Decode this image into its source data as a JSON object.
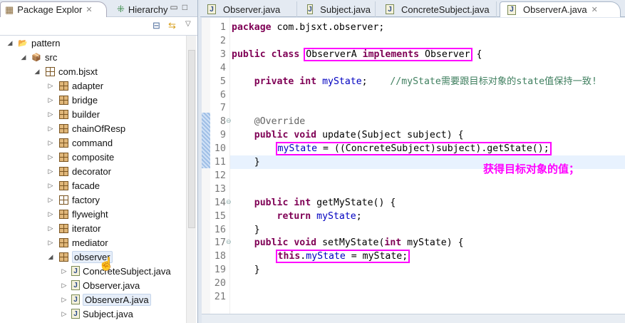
{
  "left_panel": {
    "tabs": [
      {
        "label": "Package Explor",
        "icon": "package-explorer-icon"
      },
      {
        "label": "Hierarchy",
        "icon": "hierarchy-icon"
      }
    ],
    "tree": [
      {
        "label": "pattern",
        "depth": 0,
        "twisty": "open",
        "icon": "project"
      },
      {
        "label": "src",
        "depth": 1,
        "twisty": "open",
        "icon": "src-folder"
      },
      {
        "label": "com.bjsxt",
        "depth": 2,
        "twisty": "open",
        "icon": "package-empty"
      },
      {
        "label": "adapter",
        "depth": 3,
        "twisty": "closed",
        "icon": "package"
      },
      {
        "label": "bridge",
        "depth": 3,
        "twisty": "closed",
        "icon": "package"
      },
      {
        "label": "builder",
        "depth": 3,
        "twisty": "closed",
        "icon": "package"
      },
      {
        "label": "chainOfResp",
        "depth": 3,
        "twisty": "closed",
        "icon": "package"
      },
      {
        "label": "command",
        "depth": 3,
        "twisty": "closed",
        "icon": "package"
      },
      {
        "label": "composite",
        "depth": 3,
        "twisty": "closed",
        "icon": "package"
      },
      {
        "label": "decorator",
        "depth": 3,
        "twisty": "closed",
        "icon": "package"
      },
      {
        "label": "facade",
        "depth": 3,
        "twisty": "closed",
        "icon": "package"
      },
      {
        "label": "factory",
        "depth": 3,
        "twisty": "closed",
        "icon": "package-empty"
      },
      {
        "label": "flyweight",
        "depth": 3,
        "twisty": "closed",
        "icon": "package"
      },
      {
        "label": "iterator",
        "depth": 3,
        "twisty": "closed",
        "icon": "package"
      },
      {
        "label": "mediator",
        "depth": 3,
        "twisty": "closed",
        "icon": "package"
      },
      {
        "label": "observer",
        "depth": 3,
        "twisty": "open",
        "icon": "package",
        "hover": true
      },
      {
        "label": "ConcreteSubject.java",
        "depth": 4,
        "twisty": "closed",
        "icon": "java"
      },
      {
        "label": "Observer.java",
        "depth": 4,
        "twisty": "closed",
        "icon": "java"
      },
      {
        "label": "ObserverA.java",
        "depth": 4,
        "twisty": "closed",
        "icon": "java",
        "selected": true
      },
      {
        "label": "Subject.java",
        "depth": 4,
        "twisty": "closed",
        "icon": "java"
      }
    ]
  },
  "editor": {
    "tabs": [
      {
        "label": "Observer.java"
      },
      {
        "label": "Subject.java"
      },
      {
        "label": "ConcreteSubject.java"
      },
      {
        "label": "ObserverA.java",
        "active": true,
        "close": "✕"
      }
    ],
    "current_line": 11,
    "lines": [
      [
        [
          "k",
          "package"
        ],
        [
          "p",
          " com.bjsxt.observer;"
        ]
      ],
      [],
      [
        [
          "k",
          "public"
        ],
        [
          "p",
          " "
        ],
        [
          "k",
          "class"
        ],
        [
          "p",
          " "
        ],
        {
          "box": [
            [
              "p",
              "ObserverA "
            ],
            [
              "k",
              "implements"
            ],
            [
              "p",
              " Observer"
            ]
          ]
        },
        [
          "p",
          " {"
        ]
      ],
      [],
      [
        [
          "p",
          "    "
        ],
        [
          "k",
          "private"
        ],
        [
          "p",
          " "
        ],
        [
          "k",
          "int"
        ],
        [
          "p",
          " "
        ],
        [
          "f",
          "myState"
        ],
        [
          "p",
          ";    "
        ],
        [
          "c",
          "//myState需要跟目标对象的state值保持一致!"
        ]
      ],
      [],
      [],
      [
        [
          "p",
          "    "
        ],
        [
          "a",
          "@Override"
        ]
      ],
      [
        [
          "p",
          "    "
        ],
        [
          "k",
          "public"
        ],
        [
          "p",
          " "
        ],
        [
          "k",
          "void"
        ],
        [
          "p",
          " update(Subject subject) {"
        ]
      ],
      [
        [
          "p",
          "        "
        ],
        {
          "box": [
            [
              "f",
              "myState"
            ],
            [
              "p",
              " = ((ConcreteSubject)subject).getState();"
            ]
          ]
        }
      ],
      [
        [
          "p",
          "    }"
        ]
      ],
      [],
      [],
      [
        [
          "p",
          "    "
        ],
        [
          "k",
          "public"
        ],
        [
          "p",
          " "
        ],
        [
          "k",
          "int"
        ],
        [
          "p",
          " getMyState() {"
        ]
      ],
      [
        [
          "p",
          "        "
        ],
        [
          "k",
          "return"
        ],
        [
          "p",
          " "
        ],
        [
          "f",
          "myState"
        ],
        [
          "p",
          ";"
        ]
      ],
      [
        [
          "p",
          "    }"
        ]
      ],
      [
        [
          "p",
          "    "
        ],
        [
          "k",
          "public"
        ],
        [
          "p",
          " "
        ],
        [
          "k",
          "void"
        ],
        [
          "p",
          " setMyState("
        ],
        [
          "k",
          "int"
        ],
        [
          "p",
          " myState) {"
        ]
      ],
      [
        [
          "p",
          "        "
        ],
        {
          "box": [
            [
              "k",
              "this"
            ],
            [
              "p",
              "."
            ],
            [
              "f",
              "myState"
            ],
            [
              "p",
              " = myState;"
            ]
          ]
        }
      ],
      [
        [
          "p",
          "    }"
        ]
      ],
      [],
      []
    ],
    "fold_lines": [
      8,
      14,
      17
    ],
    "annotation": "获得目标对象的值；"
  },
  "colors": {
    "highlight": "#ff00ff",
    "keyword": "#7f0055",
    "field": "#0000c0",
    "comment": "#3f7f5f"
  }
}
